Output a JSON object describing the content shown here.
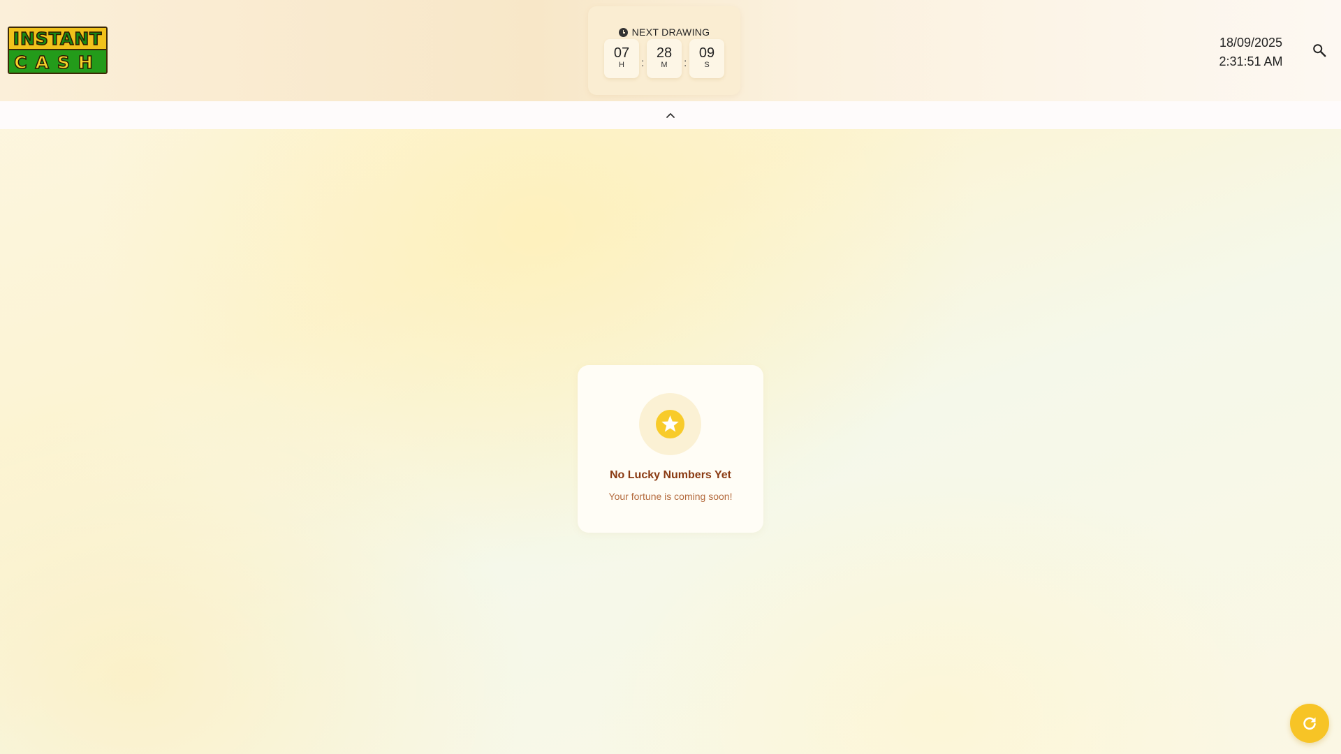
{
  "header": {
    "logo": {
      "line1": "INSTANT",
      "line2": "CASH"
    },
    "countdown": {
      "title": "NEXT DRAWING",
      "hours": "07",
      "hours_unit": "H",
      "minutes": "28",
      "minutes_unit": "M",
      "seconds": "09",
      "seconds_unit": "S",
      "separator": ":"
    },
    "date": "18/09/2025",
    "time": "2:31:51 AM",
    "search_icon": "search-icon"
  },
  "collapse": {
    "icon": "chevron-up-icon"
  },
  "empty_state": {
    "icon": "star-icon",
    "title": "No Lucky Numbers Yet",
    "subtitle": "Your fortune is coming soon!"
  },
  "fab": {
    "icon": "refresh-icon"
  },
  "colors": {
    "accent": "#f7c426",
    "title_text": "#8a3a12",
    "subtitle_text": "#b46b3e"
  }
}
